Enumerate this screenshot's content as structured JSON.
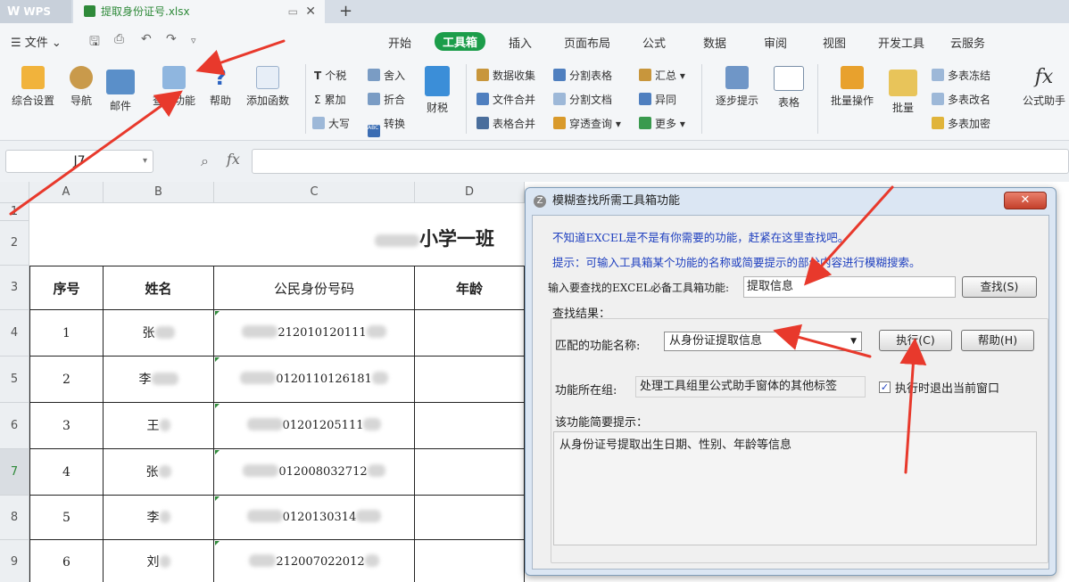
{
  "titlebar": {
    "app_tab": "WPS",
    "file_tab": "提取身份证号.xlsx",
    "file_tab_close": "✕",
    "new_tab": "+"
  },
  "menu": {
    "file": "☰ 文件 ⌄",
    "tabs": [
      "开始",
      "工具箱",
      "插入",
      "页面布局",
      "公式",
      "数据",
      "审阅",
      "视图",
      "开发工具",
      "云服务"
    ],
    "active_tab": "工具箱"
  },
  "ribbon": {
    "large": [
      "综合设置",
      "导航",
      "邮件",
      "查找功能",
      "帮助",
      "添加函数",
      "财税",
      "逐步提示",
      "表格",
      "批量操作",
      "批量",
      "公式助手"
    ],
    "small": {
      "tax": "个税",
      "sum": "累加",
      "upper": "大写",
      "in": "舍入",
      "fold": "折合",
      "convert": "转换",
      "data_collect": "数据收集",
      "file_merge": "文件合并",
      "table_merge": "表格合并",
      "split_table": "分割表格",
      "split_doc": "分割文档",
      "cross_query": "穿透查询",
      "summary": "汇总",
      "diff": "异同",
      "more": "更多",
      "multi_freeze": "多表冻结",
      "multi_rename": "多表改名",
      "multi_encrypt": "多表加密"
    },
    "tax_icon": "T",
    "sum_icon": "Σ",
    "abc_icon": "ABC 123"
  },
  "formula_bar": {
    "cell_ref": "J7",
    "fx": "fx",
    "formula": ""
  },
  "sheet": {
    "columns": [
      "A",
      "B",
      "C",
      "D"
    ],
    "rows": [
      "1",
      "2",
      "3",
      "4",
      "5",
      "6",
      "7",
      "8",
      "9"
    ],
    "selected_row": "7",
    "title": "小学一班",
    "headers": [
      "序号",
      "姓名",
      "公民身份号码",
      "年龄"
    ],
    "records": [
      {
        "no": "1",
        "name": "张",
        "id": "212010120111"
      },
      {
        "no": "2",
        "name": "李",
        "id": "0120110126181"
      },
      {
        "no": "3",
        "name": "王",
        "id": "01201205111"
      },
      {
        "no": "4",
        "name": "张",
        "id": "012008032712"
      },
      {
        "no": "5",
        "name": "李",
        "id": "0120130314"
      },
      {
        "no": "6",
        "name": "刘",
        "id": "212007022012"
      }
    ]
  },
  "dialog": {
    "title": "模糊查找所需工具箱功能",
    "close": "✕",
    "hint1": "不知道EXCEL是不是有你需要的功能，赶紧在这里查找吧。",
    "hint2": "提示：可输入工具箱某个功能的名称或简要提示的部分内容进行模糊搜索。",
    "search_label": "输入要查找的EXCEL必备工具箱功能:",
    "search_value": "提取信息",
    "search_button": "查找(S)",
    "result_label": "查找结果：",
    "match_label": "匹配的功能名称:",
    "match_value": "从身份证提取信息",
    "execute_button": "执行(C)",
    "help_button": "帮助(H)",
    "group_label": "功能所在组:",
    "group_value": "处理工具组里公式助手窗体的其他标签",
    "exit_checkbox_label": "执行时退出当前窗口",
    "exit_checked": "✓",
    "brief_label": "该功能简要提示：",
    "brief_value": "从身份证号提取出生日期、性别、年龄等信息"
  }
}
